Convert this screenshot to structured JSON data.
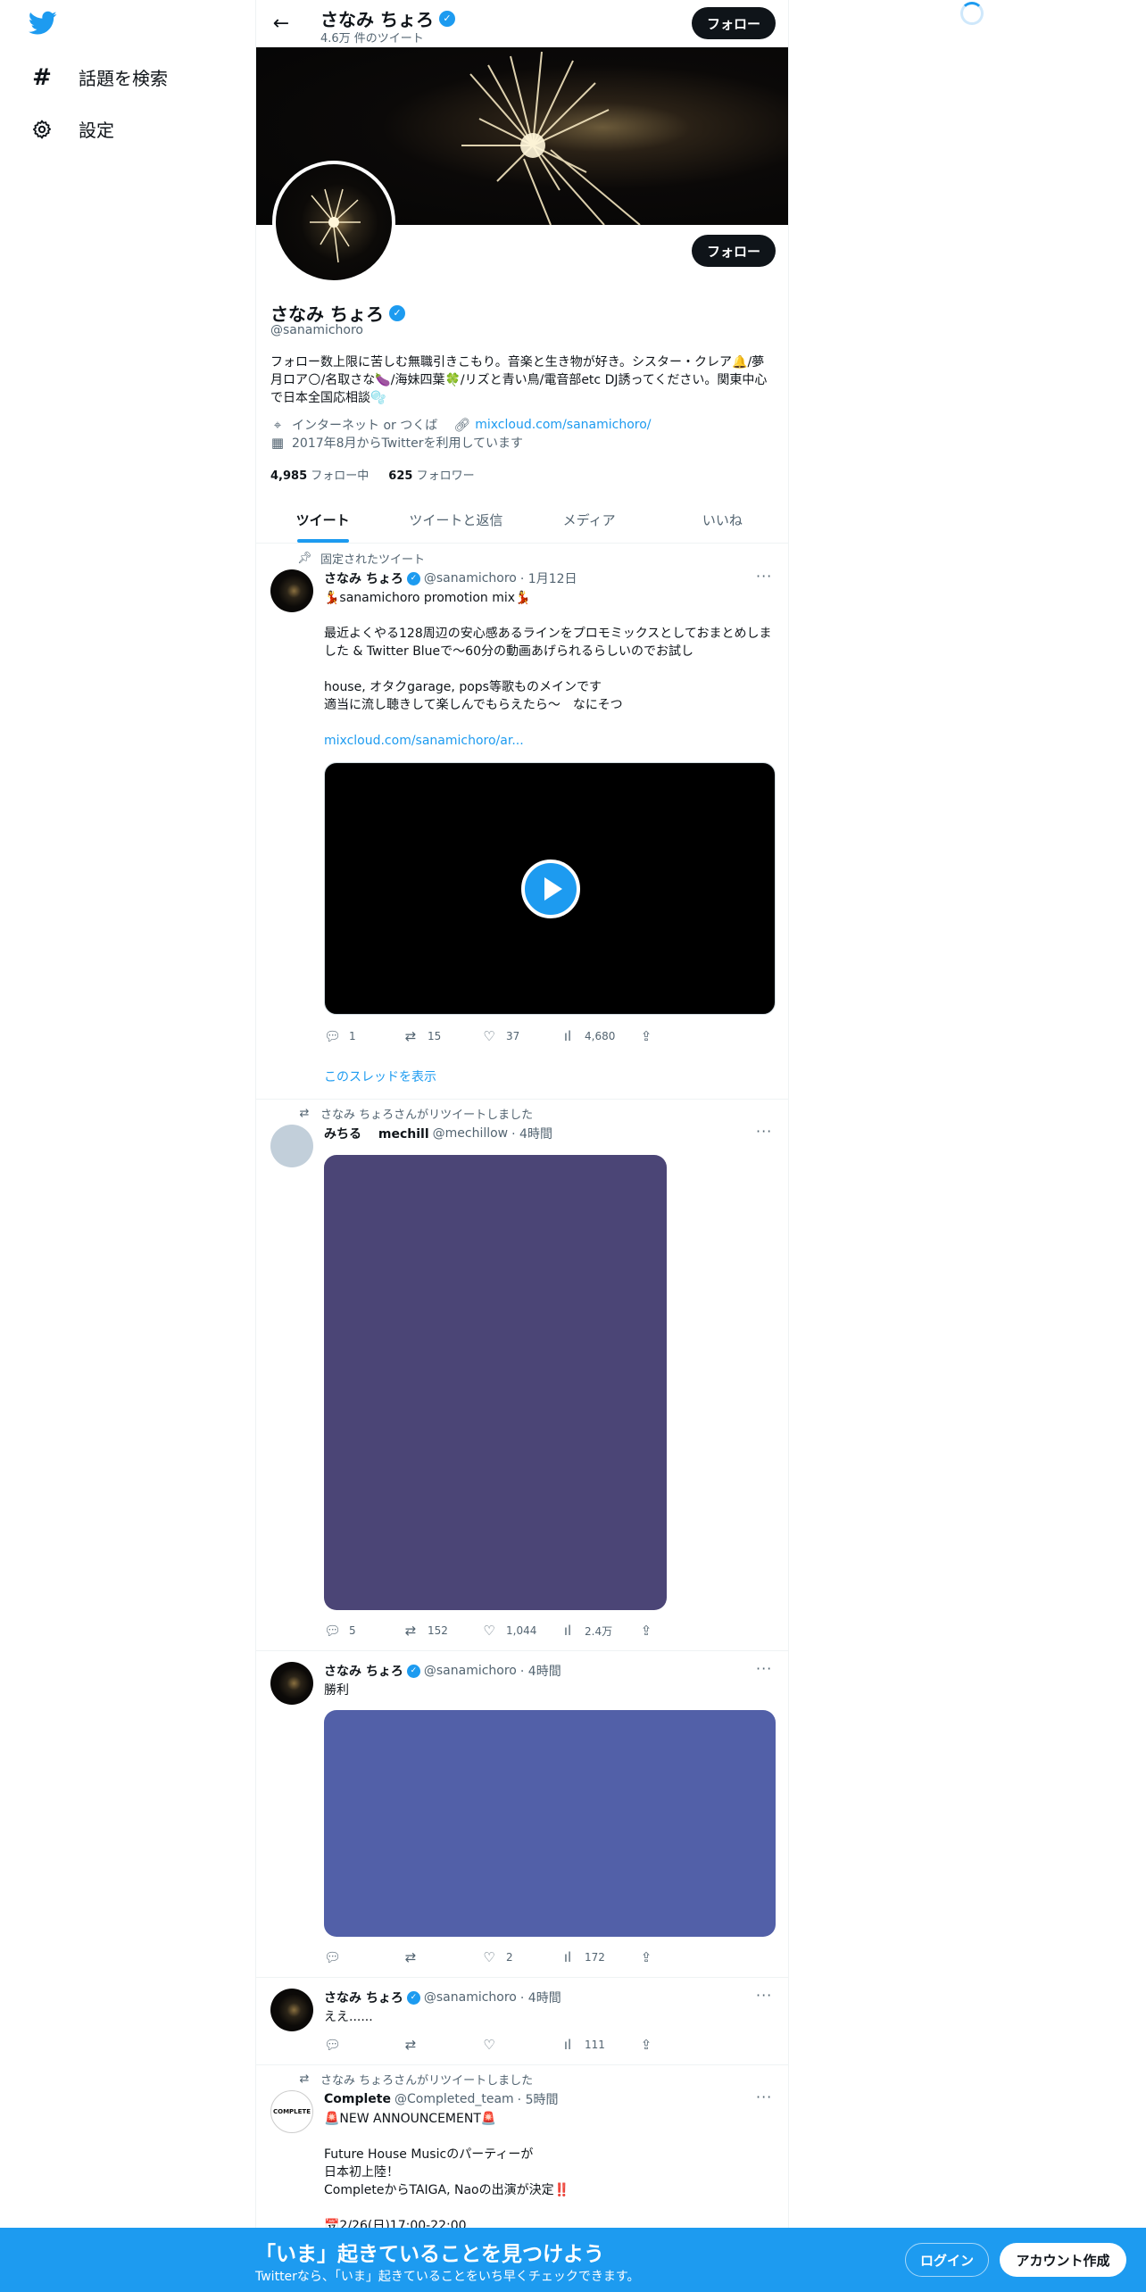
{
  "nav": {
    "explore_label": "話題を検索",
    "settings_label": "設定"
  },
  "header": {
    "name": "さなみ ちょろ",
    "tweet_count": "4.6万 件のツイート",
    "follow_label": "フォロー"
  },
  "profile": {
    "name": "さなみ ちょろ",
    "handle": "@sanamichoro",
    "follow_label": "フォロー",
    "bio": "フォロー数上限に苦しむ無職引きこもり。音楽と生き物が好き。シスター・クレア🔔/夢月ロア🌕/名取さな🍆/海妹四葉🍀/リズと青い鳥/電音部etc DJ誘ってください。関東中心で日本全国応相談🫧",
    "location": "インターネット or つくば",
    "website": "mixcloud.com/sanamichoro/",
    "joined": "2017年8月からTwitterを利用しています",
    "following_count": "4,985",
    "following_label": "フォロー中",
    "followers_count": "625",
    "followers_label": "フォロワー"
  },
  "tabs": [
    "ツイート",
    "ツイートと返信",
    "メディア",
    "いいね"
  ],
  "tweets": [
    {
      "context": "固定されたツイート",
      "name": "さなみ ちょろ",
      "handle": "@sanamichoro",
      "time": "· 1月12日",
      "text": "💃sanamichoro promotion mix💃\n\n最近よくやる128周辺の安心感あるラインをプロモミックスとしておまとめしました & Twitter Blueで〜60分の動画あげられるらしいのでお試し\n\nhouse, オタクgarage, pops等歌ものメインです\n適当に流し聴きして楽しんでもらえたら〜　なにそつ",
      "link": "mixcloud.com/sanamichoro/ar...",
      "reply": "1",
      "retweet": "15",
      "like": "37",
      "views": "4,680",
      "thread": "このスレッドを表示"
    },
    {
      "context": "さなみ ちょろさんがリツイートしました",
      "name": "みちる　 mechill",
      "handle": "@mechillow",
      "time": "· 4時間",
      "reply": "5",
      "retweet": "152",
      "like": "1,044",
      "views": "2.4万"
    },
    {
      "name": "さなみ ちょろ",
      "handle": "@sanamichoro",
      "time": "· 4時間",
      "text": "勝利",
      "reply": "",
      "retweet": "",
      "like": "2",
      "views": "172"
    },
    {
      "name": "さなみ ちょろ",
      "handle": "@sanamichoro",
      "time": "· 4時間",
      "text": "ええ......",
      "reply": "",
      "retweet": "",
      "like": "",
      "views": "111"
    },
    {
      "context": "さなみ ちょろさんがリツイートしました",
      "name": "Complete",
      "handle": "@Completed_team",
      "time": "· 5時間",
      "avatar_text": "COMPLETE",
      "text": "🚨NEW ANNOUNCEMENT🚨\n\nFuture House Musicのパーティーが\n日本初上陸！\nCompleteからTAIGA, Naoの出演が決定‼️\n\n📅2/26(日)17:00-22:00"
    }
  ],
  "bottom": {
    "title": "「いま」起きていることを見つけよう",
    "subtitle": "Twitterなら、「いま」起きていることをいち早くチェックできます。",
    "login": "ログイン",
    "signup": "アカウント作成"
  },
  "colors": {
    "accent": "#1d9bf0",
    "media_purple": "#4b4576",
    "media_blue": "#5260a8"
  }
}
